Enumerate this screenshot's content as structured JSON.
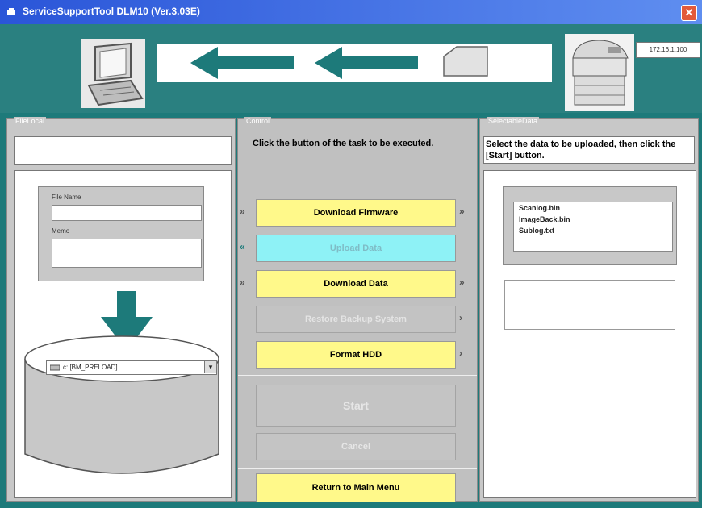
{
  "window": {
    "title": "ServiceSupportTool DLM10 (Ver.3.03E)",
    "close_label": "✕",
    "accent_color": "#1d7a7a",
    "titlebar_color": "#2a55d8"
  },
  "top": {
    "ip_address": "172.16.1.100"
  },
  "left_panel": {
    "group_title": "FileLocal",
    "file_name_label": "File Name",
    "memo_label": "Memo",
    "drive_select_value": "c: [BM_PRELOAD]"
  },
  "center_panel": {
    "group_title": "Control",
    "instruction": "Click the button of the task to be executed.",
    "buttons": {
      "download_firmware": "Download Firmware",
      "upload_data": "Upload Data",
      "download_data": "Download Data",
      "restore_backup": "Restore Backup System",
      "format_hdd": "Format HDD",
      "start": "Start",
      "cancel": "Cancel",
      "return_main": "Return to Main Menu"
    }
  },
  "right_panel": {
    "group_title": "SelectableData",
    "instruction": "Select the data to be uploaded, then click the [Start] button.",
    "files": [
      "Scanlog.bin",
      "ImageBack.bin",
      "Sublog.txt"
    ]
  }
}
